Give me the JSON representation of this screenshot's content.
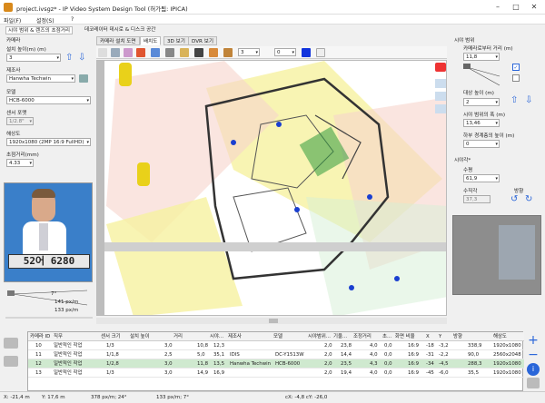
{
  "window": {
    "title": "project.ivsgz* - IP Video System Design Tool (허가됨: IPICA)"
  },
  "menu": {
    "file": "파일(F)",
    "settings": "설정(S)",
    "help": "?"
  },
  "left_panel": {
    "tab_label": "시야 범위 & 렌즈의 초점거리",
    "camera_header": "카메라",
    "install_height_label": "설치 높이(m) (m)",
    "install_height_value": "3",
    "maker_label": "제조사",
    "maker_value": "Hanwha Techwin",
    "model_label": "모델",
    "model_value": "HCB-6000",
    "sensor_label": "센서 포맷",
    "sensor_value": "1/2.8\"",
    "resolution_label": "해상도",
    "resolution_value": "1920x1080 (2MP 16:9 FullHD)",
    "focal_label": "초점거리(mm)",
    "focal_value": "4.33",
    "plate_text": "52어 6280",
    "ppm_top": "141 px/m",
    "ppm_bottom": "133 px/m",
    "angle_label": "7°"
  },
  "center": {
    "tab_group_label": "데코레이터 데시로 & 디스크 공간",
    "tabs": [
      "카메라 설치 도면",
      "배치도",
      "3D 보기",
      "DVR 보기"
    ],
    "toolbar_value1": "3",
    "toolbar_value2": "0"
  },
  "right_panel": {
    "header": "시야 범위",
    "distance_label": "카메라로부터 거리 (m)",
    "distance_value": "11,8",
    "target_height_label": "대상 높이 (m)",
    "target_height_value": "2",
    "fov_width_label": "시야 범위의 폭 (m)",
    "fov_width_value": "13,46",
    "lower_bound_label": "하부 경계층의 높이 (m)",
    "lower_bound_value": "0",
    "view_angle_header": "시야각*",
    "horizontal_label": "수평",
    "horizontal_value": "61,9",
    "vertical_label": "수직각",
    "vertical_value": "37,3",
    "direction_label": "방향"
  },
  "table": {
    "headers": [
      "카메라 ID",
      "직무",
      "센서 크기",
      "설치 높이",
      "거리",
      "시야...",
      "제조사",
      "모델",
      "시야범위...",
      "기울...",
      "조정거리",
      "초...",
      "화면 비율",
      "X",
      "Y",
      "방향",
      "해상도"
    ],
    "rows": [
      [
        "10",
        "일반적인 작업",
        "1/3",
        "3,0",
        "10,8",
        "12,3",
        "",
        "",
        "2,0",
        "23,8",
        "4,0",
        "0,0",
        "16:9",
        "-18",
        "-3,2",
        "338,9",
        "1920x1080"
      ],
      [
        "11",
        "일반적인 작업",
        "1/1,8",
        "2,5",
        "5,0",
        "35,1",
        "IDIS",
        "DC-Y1513W",
        "2,0",
        "14,4",
        "4,0",
        "0,0",
        "16:9",
        "-31",
        "-2,2",
        "90,0",
        "2560x2048"
      ],
      [
        "12",
        "일반적인 작업",
        "1/2,8",
        "3,0",
        "11,8",
        "13,5",
        "Hanwha Techwin",
        "HCB-6000",
        "2,0",
        "23,5",
        "4,3",
        "0,0",
        "16:9",
        "-34",
        "-4,5",
        "288,3",
        "1920x1080"
      ],
      [
        "13",
        "일반적인 작업",
        "1/3",
        "3,0",
        "14,9",
        "16,9",
        "",
        "",
        "2,0",
        "19,4",
        "4,0",
        "0,0",
        "16:9",
        "-45",
        "-6,0",
        "35,5",
        "1920x1080"
      ]
    ]
  },
  "status": {
    "x": "X: -21,4 m",
    "y": "Y: 17,6 m",
    "ppm": "378 px/m; 24°",
    "ppm2": "133 px/m; 7°",
    "cursor": "cX: -4,8 cY: -26,0"
  },
  "colors": {
    "accent": "#2a66d9",
    "selected_row": "#cfe9cf",
    "fov_yellow": "#f6f1a0",
    "fov_pink": "#f7d3cc"
  }
}
